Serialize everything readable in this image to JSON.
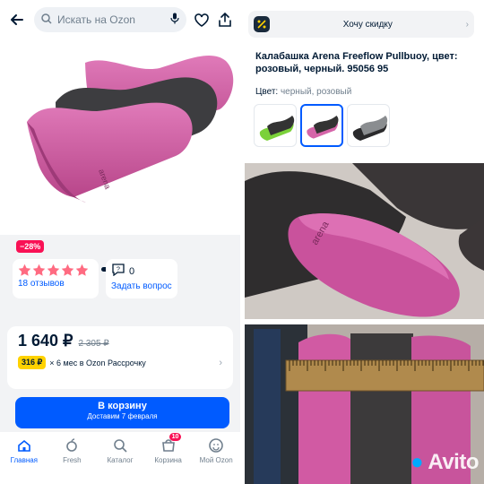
{
  "left": {
    "search": {
      "placeholder": "Искать на Ozon"
    },
    "gallery": {
      "dots": 5,
      "active_dot": 0
    },
    "discount_badge": "−28%",
    "rating": {
      "stars": 5,
      "reviews_label": "18 отзывов"
    },
    "questions": {
      "count": "0",
      "ask_label": "Задать вопрос"
    },
    "price": {
      "current": "1 640 ₽",
      "old": "2 305 ₽"
    },
    "installment": {
      "amount": "316 ₽",
      "text": "× 6 мес в Ozon Рассрочку"
    },
    "cart_button": {
      "label": "В корзину",
      "delivery": "Доставим 7 февраля"
    },
    "tabbar": [
      {
        "label": "Главная",
        "icon": "home-icon",
        "active": true
      },
      {
        "label": "Fresh",
        "icon": "fresh-icon",
        "active": false
      },
      {
        "label": "Каталог",
        "icon": "catalog-icon",
        "active": false
      },
      {
        "label": "Корзина",
        "icon": "cart-icon",
        "active": false,
        "badge": "10"
      },
      {
        "label": "Мой Ozon",
        "icon": "profile-icon",
        "active": false
      }
    ]
  },
  "right": {
    "want_discount": "Хочу скидку",
    "product_title": "Калабашка Arena Freeflow Pullbuoy, цвет: розовый, черный. 95056 95",
    "color_label": "Цвет:",
    "color_value": "черный, розовый",
    "swatches": [
      "green-black",
      "pink-black",
      "black-grey"
    ]
  },
  "watermark": {
    "text": "Avito"
  },
  "colors": {
    "accent": "#005bff",
    "sale": "#f91155",
    "installment": "#ffd200",
    "star": "#ff6b81",
    "product_pink": "#c9589e",
    "product_black": "#3a3a3c"
  }
}
